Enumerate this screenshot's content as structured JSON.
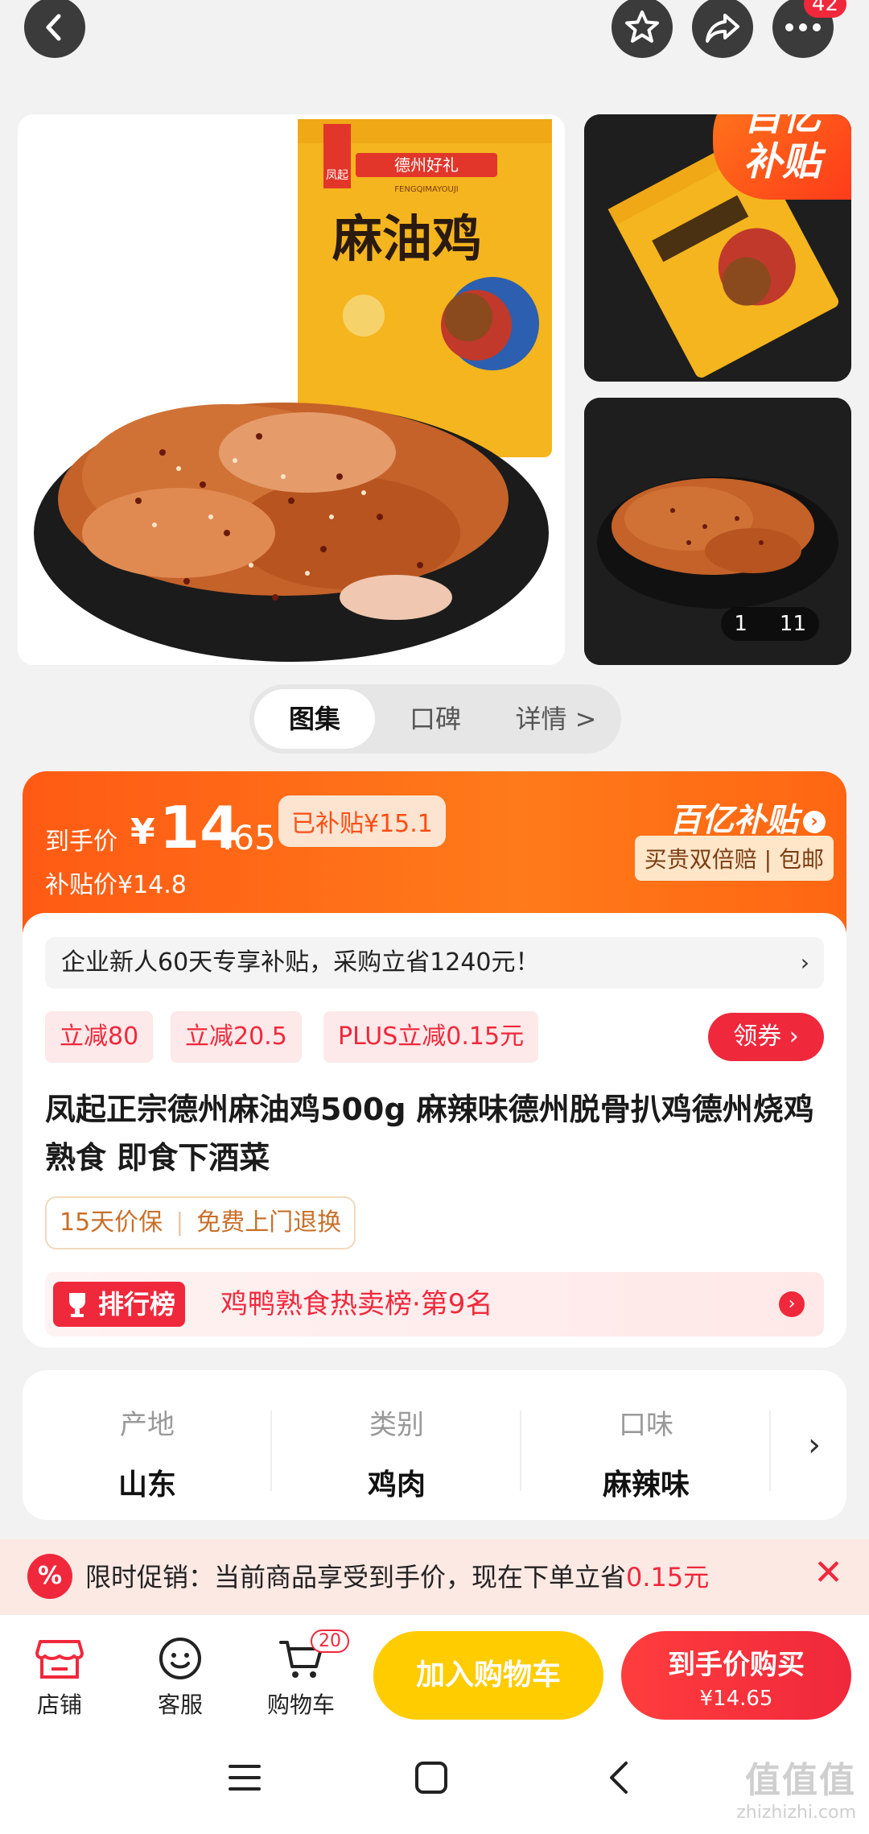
{
  "topbar": {
    "more_badge": "42"
  },
  "gallery": {
    "subsidy_tag_line1": "百亿",
    "subsidy_tag_line2": "补贴",
    "package_brand": "凤起",
    "package_subtitle": "德州好礼",
    "package_pinyin": "FENGQIMAYOUJI",
    "package_name": "麻油鸡",
    "counter_current": "1",
    "counter_total": "11"
  },
  "tabs": [
    {
      "label": "图集"
    },
    {
      "label": "口碑"
    },
    {
      "label": "详情 >"
    }
  ],
  "price": {
    "label": "到手价",
    "currency": "¥",
    "integer": "14",
    "decimal": ".65",
    "subsidized": "已补贴¥15.1",
    "subsidy_price": "补贴价¥14.8",
    "program_logo": "百亿补贴",
    "program_promise": "买贵双倍赔 | 包邮"
  },
  "notice": {
    "text": "企业新人60天专享补贴，采购立省1240元！",
    "chevron": "›"
  },
  "coupons": [
    {
      "label": "立减80"
    },
    {
      "label": "立减20.5"
    },
    {
      "label": "PLUS立减0.15元"
    }
  ],
  "get_coupon_label": "领券",
  "product_title": "凤起正宗德州麻油鸡500g 麻辣味德州脱骨扒鸡德州烧鸡熟食 即食下酒菜",
  "guarantees": {
    "a": "15天价保",
    "b": "免费上门退换"
  },
  "rank": {
    "badge": "排行榜",
    "text": "鸡鸭熟食热卖榜·第9名"
  },
  "attributes": [
    {
      "key": "产地",
      "value": "山东"
    },
    {
      "key": "类别",
      "value": "鸡肉"
    },
    {
      "key": "口味",
      "value": "麻辣味"
    }
  ],
  "promo": {
    "text_prefix": "限时促销：当前商品享受到手价，现在下单立省",
    "amount": "0.15元"
  },
  "bottombar": {
    "store": "店铺",
    "service": "客服",
    "cart": "购物车",
    "cart_count": "20",
    "add_to_cart": "加入购物车",
    "buy_label": "到手价购买",
    "buy_price": "¥14.65"
  },
  "watermark": {
    "logo": "值值值",
    "url": "zhizhizhi.com"
  },
  "colors": {
    "accent_red": "#f0283c",
    "accent_orange": "#ff5a14",
    "cart_yellow": "#ffcc00"
  }
}
